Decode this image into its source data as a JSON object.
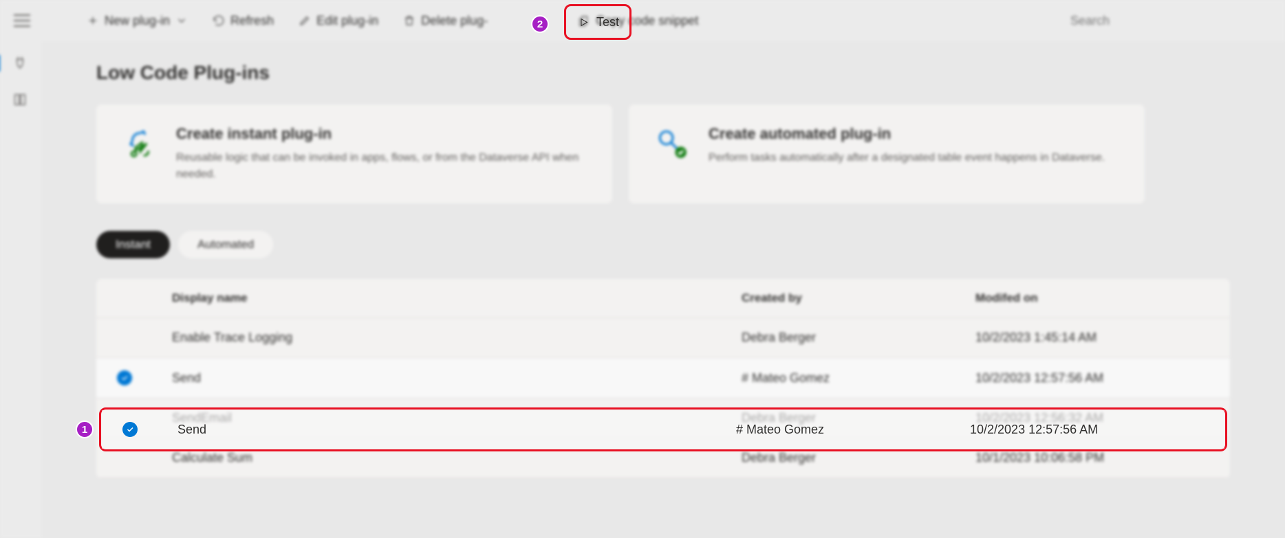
{
  "toolbar": {
    "new_plugin": "New plug-in",
    "refresh": "Refresh",
    "edit": "Edit plug-in",
    "delete": "Delete plug-",
    "test": "Test",
    "copy": "Copy code snippet",
    "search_placeholder": "Search"
  },
  "page": {
    "title": "Low Code Plug-ins"
  },
  "cards": {
    "instant": {
      "title": "Create instant plug-in",
      "desc": "Reusable logic that can be invoked in apps, flows, or from the Dataverse API when needed."
    },
    "automated": {
      "title": "Create automated plug-in",
      "desc": "Perform tasks automatically after a designated table event happens in Dataverse."
    }
  },
  "tabs": {
    "instant": "Instant",
    "automated": "Automated"
  },
  "table": {
    "headers": {
      "display_name": "Display name",
      "created_by": "Created by",
      "modified_on": "Modifed on"
    },
    "rows": [
      {
        "name": "Enable Trace Logging",
        "by": "Debra Berger",
        "on": "10/2/2023 1:45:14 AM"
      },
      {
        "name": "Send",
        "by": "# Mateo Gomez",
        "on": "10/2/2023 12:57:56 AM"
      },
      {
        "name": "SendEmail",
        "by": "Debra Berger",
        "on": "10/2/2023 12:56:32 AM"
      },
      {
        "name": "Calculate Sum",
        "by": "Debra Berger",
        "on": "10/1/2023 10:06:58 PM"
      }
    ]
  },
  "callouts": {
    "one": "1",
    "two": "2"
  }
}
